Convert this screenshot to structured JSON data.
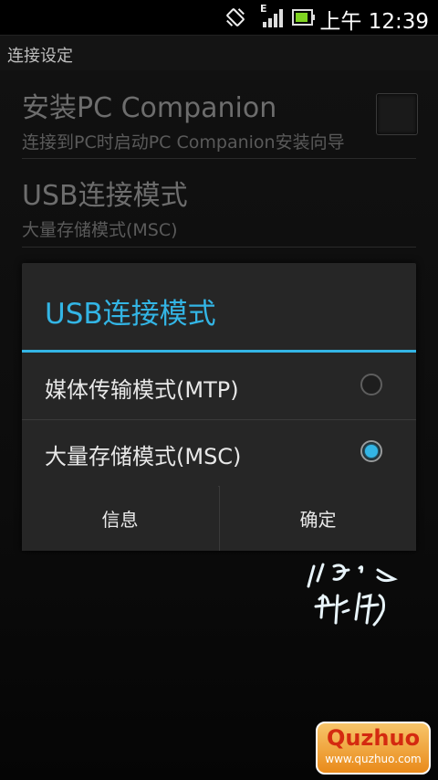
{
  "status_bar": {
    "time": "上午 12:39",
    "network_type": "E",
    "icons": [
      "vibrate-icon",
      "signal-icon",
      "battery-icon"
    ]
  },
  "title_bar": {
    "title": "连接设定"
  },
  "settings": [
    {
      "title": "安装PC Companion",
      "summary": "连接到PC时启动PC Companion安装向导",
      "checked": false
    },
    {
      "title": "USB连接模式",
      "summary": "大量存储模式(MSC)"
    }
  ],
  "dialog": {
    "title": "USB连接模式",
    "options": [
      {
        "label": "媒体传输模式(MTP)",
        "selected": false
      },
      {
        "label": "大量存储模式(MSC)",
        "selected": true
      }
    ],
    "buttons": {
      "info": "信息",
      "ok": "确定"
    }
  },
  "watermark": {
    "site_name": "Quzhuo",
    "site_url": "www.quzhuo.com"
  },
  "colors": {
    "accent": "#33b5e5",
    "dialog_bg": "#262626",
    "background": "#000000"
  }
}
